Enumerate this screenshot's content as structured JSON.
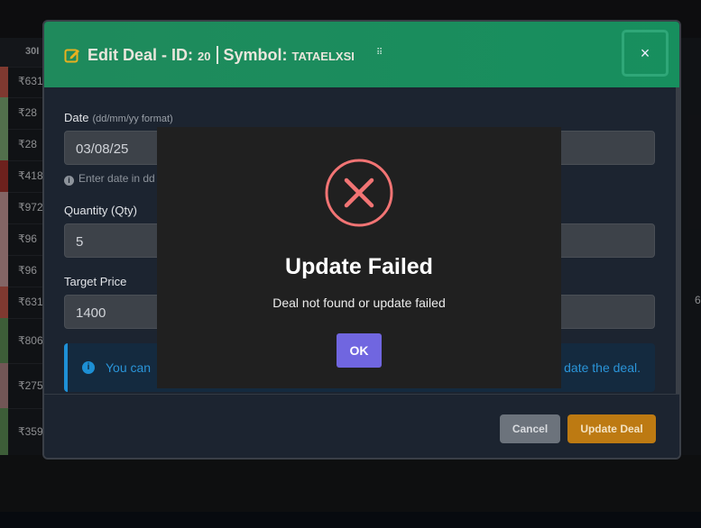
{
  "background_table": {
    "header_label": "30I",
    "prices": [
      "₹631",
      "₹28",
      "₹28",
      "₹418",
      "₹972",
      "₹96",
      "₹96",
      "₹631",
      "₹806",
      "₹275",
      "₹359"
    ],
    "right_fragment": "6"
  },
  "modal": {
    "title_prefix": "Edit Deal - ID:",
    "deal_id": "20",
    "symbol_label": "Symbol:",
    "symbol": "TATAELXSI",
    "close_label": "×",
    "date_label": "Date",
    "date_hint": "(dd/mm/yy format)",
    "date_value": "03/08/25",
    "date_helper": "Enter date in dd",
    "qty_label": "Quantity (Qty)",
    "qty_value": "5",
    "target_label": "Target Price",
    "target_value": "1400",
    "alert_left": "You can",
    "alert_right": "date the deal.",
    "cancel_label": "Cancel",
    "update_label": "Update Deal"
  },
  "error_dialog": {
    "title": "Update Failed",
    "message": "Deal not found or update failed",
    "ok_label": "OK"
  },
  "colors": {
    "header_green": "#1f8a5c",
    "error_red": "#f27474",
    "ok_purple": "#7066e0",
    "update_orange": "#bd7a12",
    "info_blue": "#2a94d8"
  }
}
